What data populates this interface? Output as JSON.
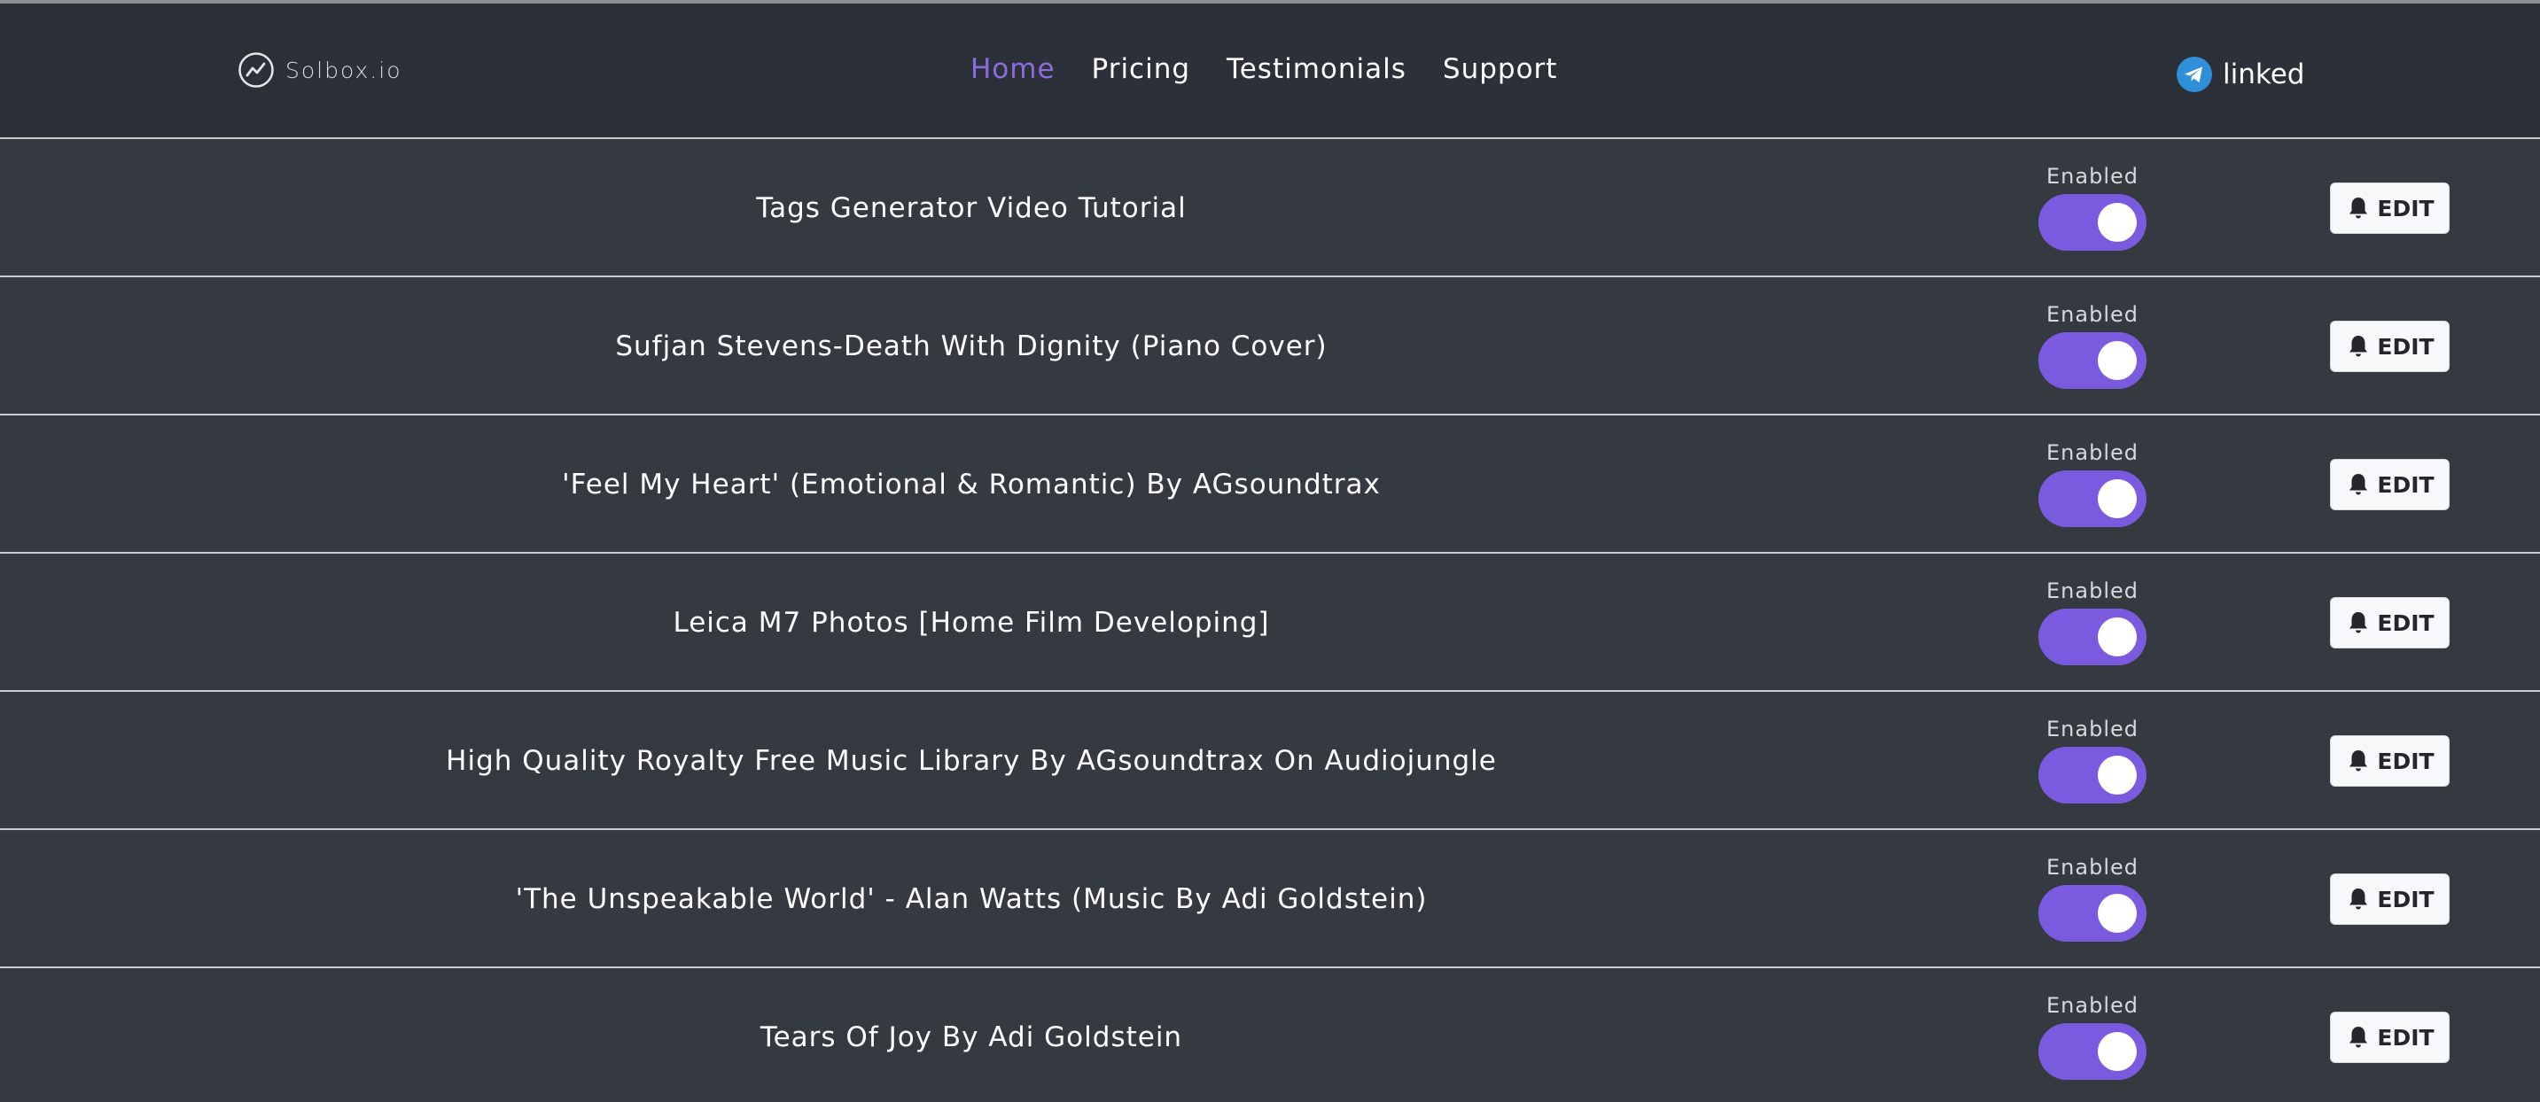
{
  "brand": {
    "name": "Solbox.io"
  },
  "nav": {
    "items": [
      {
        "label": "Home",
        "active": true
      },
      {
        "label": "Pricing",
        "active": false
      },
      {
        "label": "Testimonials",
        "active": false
      },
      {
        "label": "Support",
        "active": false
      }
    ]
  },
  "telegram": {
    "label": "linked"
  },
  "colors": {
    "accent": "#7a5be0",
    "nav_active": "#8c6cdc",
    "background": "#353a40",
    "navbar": "#2c3139",
    "telegram": "#2f8fd8"
  },
  "rows": [
    {
      "title": "Tags Generator Video Tutorial",
      "status_label": "Enabled",
      "enabled": true,
      "edit_label": "EDIT"
    },
    {
      "title": "Sufjan Stevens-Death With Dignity (Piano Cover)",
      "status_label": "Enabled",
      "enabled": true,
      "edit_label": "EDIT"
    },
    {
      "title": "'Feel My Heart' (Emotional & Romantic) By AGsoundtrax",
      "status_label": "Enabled",
      "enabled": true,
      "edit_label": "EDIT"
    },
    {
      "title": "Leica M7 Photos [Home Film Developing]",
      "status_label": "Enabled",
      "enabled": true,
      "edit_label": "EDIT"
    },
    {
      "title": "High Quality Royalty Free Music Library By AGsoundtrax On Audiojungle",
      "status_label": "Enabled",
      "enabled": true,
      "edit_label": "EDIT"
    },
    {
      "title": "'The Unspeakable World' - Alan Watts (Music By Adi Goldstein)",
      "status_label": "Enabled",
      "enabled": true,
      "edit_label": "EDIT"
    },
    {
      "title": "Tears Of Joy By Adi Goldstein",
      "status_label": "Enabled",
      "enabled": true,
      "edit_label": "EDIT"
    }
  ]
}
